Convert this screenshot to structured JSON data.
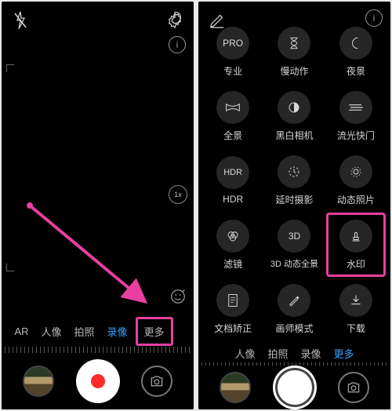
{
  "left": {
    "zoom_label": "1x",
    "modes": {
      "ar": "AR",
      "portrait": "人像",
      "photo": "拍照",
      "video": "录像",
      "more": "更多"
    }
  },
  "right": {
    "modes": {
      "portrait": "人像",
      "photo": "拍照",
      "video": "录像",
      "more": "更多"
    },
    "tiles": {
      "pro": {
        "icon": "PRO",
        "label": "专业"
      },
      "slowmo": {
        "label": "慢动作"
      },
      "night": {
        "label": "夜景"
      },
      "panorama": {
        "label": "全景"
      },
      "mono": {
        "label": "黑白相机"
      },
      "lightpaint": {
        "label": "流光快门"
      },
      "hdr": {
        "icon": "HDR",
        "label": "HDR"
      },
      "timelapse": {
        "label": "延时摄影"
      },
      "livephoto": {
        "label": "动态照片"
      },
      "filter": {
        "label": "滤镜"
      },
      "pano3d": {
        "icon": "3D",
        "label": "3D 动态全景"
      },
      "watermark": {
        "label": "水印"
      },
      "docscan": {
        "label": "文档矫正"
      },
      "artist": {
        "label": "画师模式"
      },
      "download": {
        "label": "下载"
      }
    }
  }
}
